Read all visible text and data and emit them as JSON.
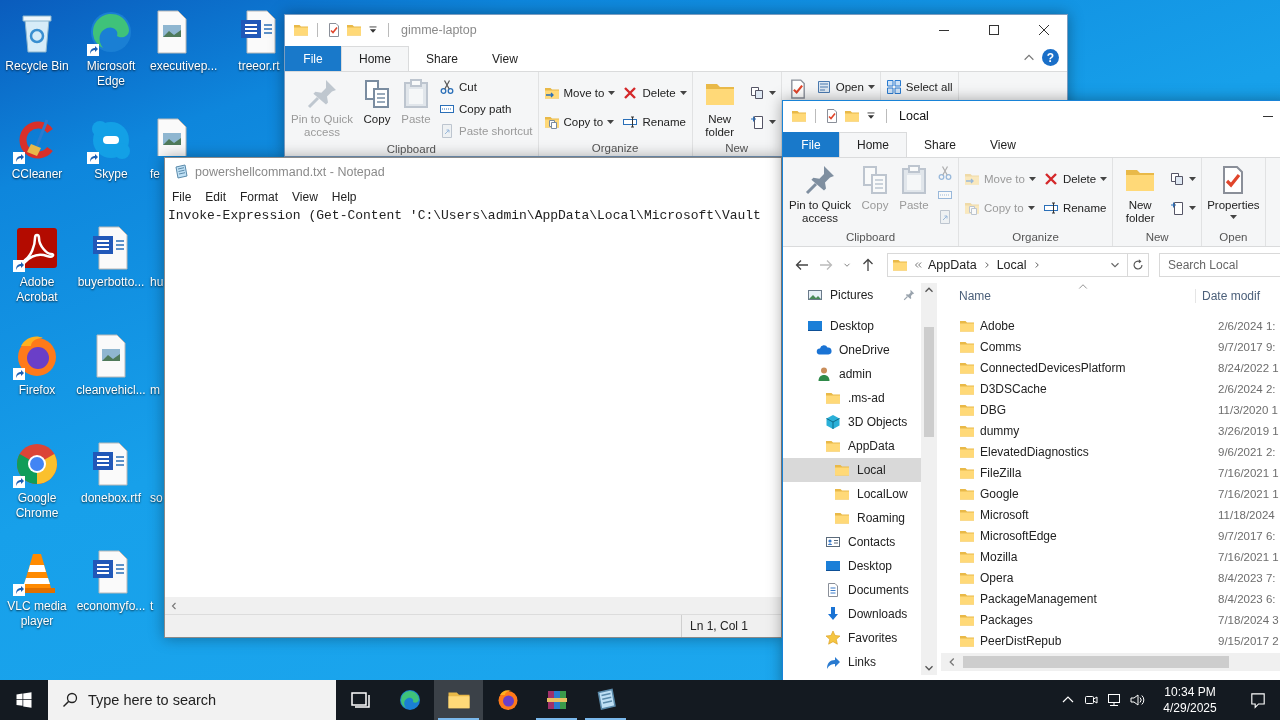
{
  "desktop": {
    "columns": [
      [
        {
          "label": "Recycle Bin",
          "kind": "recycle",
          "shortcut": false
        },
        {
          "label": "CCleaner",
          "kind": "cleaner",
          "shortcut": true
        },
        {
          "label": "Adobe Acrobat",
          "kind": "pdf",
          "shortcut": true
        },
        {
          "label": "Firefox",
          "kind": "firefox",
          "shortcut": true
        },
        {
          "label": "Google Chrome",
          "kind": "chrome",
          "shortcut": true
        },
        {
          "label": "VLC media player",
          "kind": "cone",
          "shortcut": true
        }
      ],
      [
        {
          "label": "Microsoft Edge",
          "kind": "edge",
          "shortcut": true
        },
        {
          "label": "Skype",
          "kind": "chat",
          "shortcut": true
        },
        {
          "label": "buyerbotto...",
          "kind": "doc",
          "shortcut": false
        },
        {
          "label": "cleanvehicl...",
          "kind": "image",
          "shortcut": false
        },
        {
          "label": "donebox.rtf",
          "kind": "doc",
          "shortcut": false
        },
        {
          "label": "economyfo...",
          "kind": "doc",
          "shortcut": false
        }
      ],
      [
        {
          "label": "executivep...",
          "kind": "image",
          "shortcut": false
        },
        {
          "label": "fe",
          "kind": "image",
          "shortcut": false
        },
        {
          "label": "hu",
          "shortcut": false
        },
        {
          "label": "m",
          "shortcut": false
        },
        {
          "label": "so",
          "shortcut": false
        },
        {
          "label": "t",
          "shortcut": false
        }
      ],
      [
        {
          "label": "treeor.rt",
          "kind": "doc",
          "shortcut": false
        }
      ]
    ]
  },
  "explorer_back": {
    "title": "gimme-laptop",
    "tabs": [
      {
        "label": "File",
        "kind": "menu",
        "selected": false
      },
      {
        "label": "Home",
        "kind": "tab",
        "selected": true
      },
      {
        "label": "Share",
        "kind": "tab",
        "selected": false
      },
      {
        "label": "View",
        "kind": "tab",
        "selected": false
      }
    ],
    "help": "?",
    "ribbon": [
      {
        "label": "Clipboard",
        "items": [
          {
            "kind": "large",
            "label": "Pin to Quick access",
            "disabled": true,
            "dropdown": false
          },
          {
            "kind": "large",
            "label": "Copy",
            "disabled": false,
            "dropdown": false
          },
          {
            "kind": "large",
            "label": "Paste",
            "disabled": true,
            "dropdown": false
          },
          {
            "kind": "stack",
            "items": [
              {
                "label": "Cut",
                "disabled": false,
                "dropdown": false
              },
              {
                "label": "Copy path",
                "disabled": false,
                "dropdown": false
              },
              {
                "label": "Paste shortcut",
                "disabled": true,
                "dropdown": false
              }
            ]
          }
        ]
      },
      {
        "label": "Organize",
        "items": [
          {
            "kind": "stack",
            "items": [
              {
                "label": "Move to",
                "disabled": false,
                "dropdown": true
              },
              {
                "label": "Copy to",
                "disabled": false,
                "dropdown": true
              }
            ]
          },
          {
            "kind": "stack",
            "items": [
              {
                "label": "Delete",
                "disabled": false,
                "dropdown": true
              },
              {
                "label": "Rename",
                "disabled": false,
                "dropdown": false
              }
            ]
          }
        ]
      },
      {
        "label": "New",
        "items": [
          {
            "kind": "large",
            "label": "New folder",
            "disabled": false,
            "dropdown": false
          },
          {
            "kind": "stack",
            "items": [
              {
                "disabled": false,
                "dropdown": true
              },
              {
                "disabled": false,
                "dropdown": true
              }
            ]
          }
        ]
      },
      {
        "items": [
          {
            "kind": "large",
            "disabled": false,
            "dropdown": false
          },
          {
            "kind": "stack",
            "items": [
              {
                "label": "Open",
                "disabled": false,
                "dropdown": true
              }
            ]
          }
        ]
      },
      {
        "items": [
          {
            "kind": "stack",
            "items": [
              {
                "label": "Select all",
                "disabled": false,
                "dropdown": false
              }
            ]
          }
        ]
      }
    ]
  },
  "notepad": {
    "title": "powershellcommand.txt - Notepad",
    "menu": [
      "File",
      "Edit",
      "Format",
      "View",
      "Help"
    ],
    "text": "Invoke-Expression (Get-Content 'C:\\Users\\admin\\AppData\\Local\\Microsoft\\Vault",
    "status": "Ln 1, Col 1"
  },
  "explorer_front": {
    "title": "Local",
    "tabs": [
      {
        "label": "File",
        "kind": "menu",
        "selected": false
      },
      {
        "label": "Home",
        "kind": "tab",
        "selected": true
      },
      {
        "label": "Share",
        "kind": "tab",
        "selected": false
      },
      {
        "label": "View",
        "kind": "tab",
        "selected": false
      }
    ],
    "ribbon": [
      {
        "label": "Clipboard",
        "items": [
          {
            "kind": "large",
            "label": "Pin to Quick access",
            "disabled": false,
            "dropdown": false
          },
          {
            "kind": "large",
            "label": "Copy",
            "disabled": true,
            "dropdown": false
          },
          {
            "kind": "large",
            "label": "Paste",
            "disabled": true,
            "dropdown": false
          },
          {
            "kind": "stack",
            "items": [
              {
                "disabled": true,
                "dropdown": false
              },
              {
                "disabled": true,
                "dropdown": false
              },
              {
                "disabled": true,
                "dropdown": false
              }
            ]
          }
        ]
      },
      {
        "label": "Organize",
        "items": [
          {
            "kind": "stack",
            "items": [
              {
                "label": "Move to",
                "disabled": true,
                "dropdown": true
              },
              {
                "label": "Copy to",
                "disabled": true,
                "dropdown": true
              }
            ]
          },
          {
            "kind": "stack",
            "items": [
              {
                "label": "Delete",
                "disabled": false,
                "dropdown": true
              },
              {
                "label": "Rename",
                "disabled": false,
                "dropdown": false
              }
            ]
          }
        ]
      },
      {
        "label": "New",
        "items": [
          {
            "kind": "large",
            "label": "New folder",
            "disabled": false,
            "dropdown": false
          },
          {
            "kind": "stack",
            "items": [
              {
                "disabled": false,
                "dropdown": true
              },
              {
                "disabled": false,
                "dropdown": true
              }
            ]
          }
        ]
      },
      {
        "label": "Open",
        "items": [
          {
            "kind": "large",
            "label": "Properties",
            "disabled": false,
            "dropdown": true
          }
        ]
      }
    ],
    "address": {
      "path": [
        "AppData",
        "Local"
      ]
    },
    "search": {
      "placeholder": "Search Local"
    },
    "nav": [
      {
        "label": "Pictures",
        "kind": "pictures",
        "pinned": true,
        "selected": false
      },
      {
        "label": "Desktop",
        "kind": "desktop",
        "pinned": false,
        "selected": false,
        "children": [
          {
            "label": "OneDrive",
            "kind": "cloud",
            "pinned": false,
            "selected": false
          },
          {
            "label": "admin",
            "kind": "user",
            "pinned": false,
            "selected": false,
            "children": [
              {
                "label": ".ms-ad",
                "kind": "folder",
                "pinned": false,
                "selected": false
              },
              {
                "label": "3D Objects",
                "kind": "cube",
                "pinned": false,
                "selected": false
              },
              {
                "label": "AppData",
                "kind": "folder",
                "pinned": false,
                "selected": false,
                "children": [
                  {
                    "label": "Local",
                    "kind": "folder",
                    "pinned": false,
                    "selected": true
                  },
                  {
                    "label": "LocalLow",
                    "kind": "folder",
                    "pinned": false,
                    "selected": false
                  },
                  {
                    "label": "Roaming",
                    "kind": "folder",
                    "pinned": false,
                    "selected": false
                  }
                ]
              },
              {
                "label": "Contacts",
                "kind": "contacts",
                "pinned": false,
                "selected": false
              },
              {
                "label": "Desktop",
                "kind": "desktop",
                "pinned": false,
                "selected": false
              },
              {
                "label": "Documents",
                "kind": "documents",
                "pinned": false,
                "selected": false
              },
              {
                "label": "Downloads",
                "kind": "downloads",
                "pinned": false,
                "selected": false
              },
              {
                "label": "Favorites",
                "kind": "star",
                "pinned": false,
                "selected": false
              },
              {
                "label": "Links",
                "kind": "link",
                "pinned": false,
                "selected": false
              }
            ]
          }
        ]
      }
    ],
    "columns": [
      "Name",
      "Date modif"
    ],
    "files": [
      {
        "name": "Adobe",
        "date": "2/6/2024 1:"
      },
      {
        "name": "Comms",
        "date": "9/7/2017 9:"
      },
      {
        "name": "ConnectedDevicesPlatform",
        "date": "8/24/2022 1"
      },
      {
        "name": "D3DSCache",
        "date": "2/6/2024 2:"
      },
      {
        "name": "DBG",
        "date": "11/3/2020 1"
      },
      {
        "name": "dummy",
        "date": "3/26/2019 1"
      },
      {
        "name": "ElevatedDiagnostics",
        "date": "9/6/2021 2:"
      },
      {
        "name": "FileZilla",
        "date": "7/16/2021 1"
      },
      {
        "name": "Google",
        "date": "7/16/2021 1"
      },
      {
        "name": "Microsoft",
        "date": "11/18/2024"
      },
      {
        "name": "MicrosoftEdge",
        "date": "9/7/2017 6:"
      },
      {
        "name": "Mozilla",
        "date": "7/16/2021 1"
      },
      {
        "name": "Opera",
        "date": "8/4/2023 7:"
      },
      {
        "name": "PackageManagement",
        "date": "8/4/2023 6:"
      },
      {
        "name": "Packages",
        "date": "7/18/2024 3"
      },
      {
        "name": "PeerDistRepub",
        "date": "9/15/2017 2"
      }
    ]
  },
  "taskbar": {
    "search": {
      "placeholder": "Type here to search"
    },
    "apps": [
      {
        "kind": "taskview",
        "running": false,
        "selected": false
      },
      {
        "kind": "edge",
        "running": false,
        "selected": false
      },
      {
        "kind": "explorer",
        "running": true,
        "selected": true
      },
      {
        "kind": "firefox",
        "running": false,
        "selected": false
      },
      {
        "kind": "archive",
        "running": true,
        "selected": false
      },
      {
        "kind": "notepad",
        "running": true,
        "selected": false
      }
    ],
    "time": "10:34 PM",
    "date": "4/29/2025"
  }
}
